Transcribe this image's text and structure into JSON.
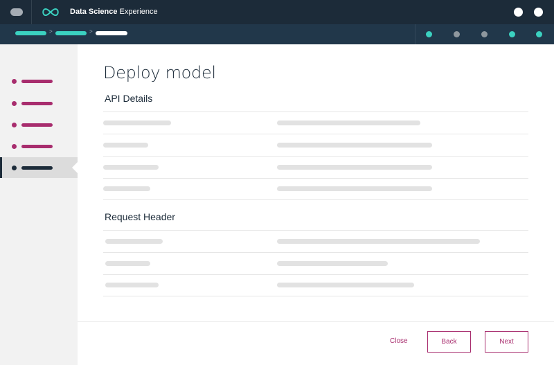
{
  "header": {
    "app_title_bold": "Data Science",
    "app_title_light": "Experience"
  },
  "page": {
    "title": "Deploy model",
    "sections": {
      "api_details": "API Details",
      "request_header": "Request Header"
    }
  },
  "footer": {
    "close_label": "Close",
    "back_label": "Back",
    "next_label": "Next"
  },
  "colors": {
    "topbar": "#1c2b39",
    "subbar": "#21374a",
    "accent_teal": "#3bd1c0",
    "accent_magenta": "#a82d6e",
    "step_inactive": "#8e979e"
  },
  "sidebar": {
    "items": [
      {
        "color": "#a82d6e",
        "active": false
      },
      {
        "color": "#a82d6e",
        "active": false
      },
      {
        "color": "#a82d6e",
        "active": false
      },
      {
        "color": "#a82d6e",
        "active": false
      },
      {
        "color": "#1c2b39",
        "active": true
      }
    ]
  },
  "steps": [
    {
      "state": "done",
      "color": "#3bd1c0"
    },
    {
      "state": "pending",
      "color": "#8e979e"
    },
    {
      "state": "pending",
      "color": "#8e979e"
    },
    {
      "state": "done",
      "color": "#3bd1c0"
    },
    {
      "state": "done",
      "color": "#3bd1c0"
    }
  ]
}
